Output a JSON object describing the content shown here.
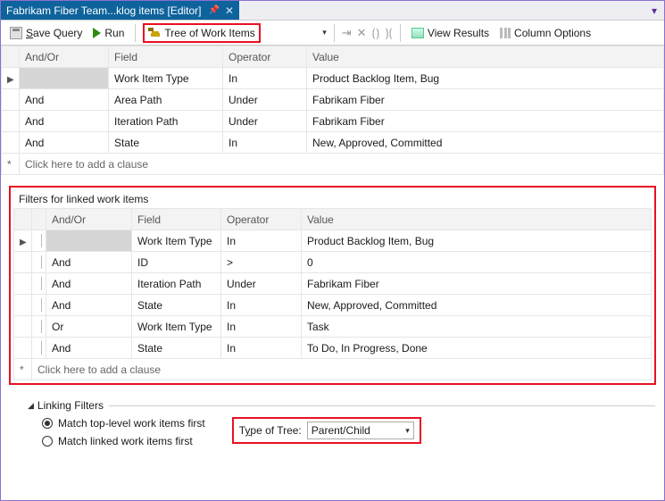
{
  "tab": {
    "title": "Fabrikam Fiber Team...klog items [Editor]"
  },
  "toolbar": {
    "save_label": "Save Query",
    "run_label": "Run",
    "tree_label": "Tree of Work Items",
    "view_results_label": "View Results",
    "column_options_label": "Column Options"
  },
  "columns": {
    "andor": "And/Or",
    "field": "Field",
    "operator": "Operator",
    "value": "Value"
  },
  "top_clauses": [
    {
      "marker": "▶",
      "andor": "",
      "field": "Work Item Type",
      "op": "In",
      "value": "Product Backlog Item, Bug"
    },
    {
      "marker": "",
      "andor": "And",
      "field": "Area Path",
      "op": "Under",
      "value": "Fabrikam Fiber"
    },
    {
      "marker": "",
      "andor": "And",
      "field": "Iteration Path",
      "op": "Under",
      "value": "Fabrikam Fiber"
    },
    {
      "marker": "",
      "andor": "And",
      "field": "State",
      "op": "In",
      "value": "New, Approved, Committed"
    }
  ],
  "add_clause_marker": "*",
  "add_clause_text": "Click here to add a clause",
  "linked": {
    "title": "Filters for linked work items",
    "clauses": [
      {
        "marker": "▶",
        "andor": "",
        "field": "Work Item Type",
        "op": "In",
        "value": "Product Backlog Item, Bug"
      },
      {
        "marker": "",
        "andor": "And",
        "field": "ID",
        "op": ">",
        "value": "0"
      },
      {
        "marker": "",
        "andor": "And",
        "field": "Iteration Path",
        "op": "Under",
        "value": "Fabrikam Fiber"
      },
      {
        "marker": "",
        "andor": "And",
        "field": "State",
        "op": "In",
        "value": "New, Approved, Committed"
      },
      {
        "marker": "",
        "andor": "Or",
        "field": "Work Item Type",
        "op": "In",
        "value": "Task"
      },
      {
        "marker": "",
        "andor": "And",
        "field": "State",
        "op": "In",
        "value": "To Do, In Progress, Done"
      }
    ]
  },
  "linking": {
    "group_label": "Linking Filters",
    "radio_top": "Match top-level work items first",
    "radio_linked": "Match linked work items first",
    "type_label": "Type of Tree:",
    "type_value": "Parent/Child"
  }
}
